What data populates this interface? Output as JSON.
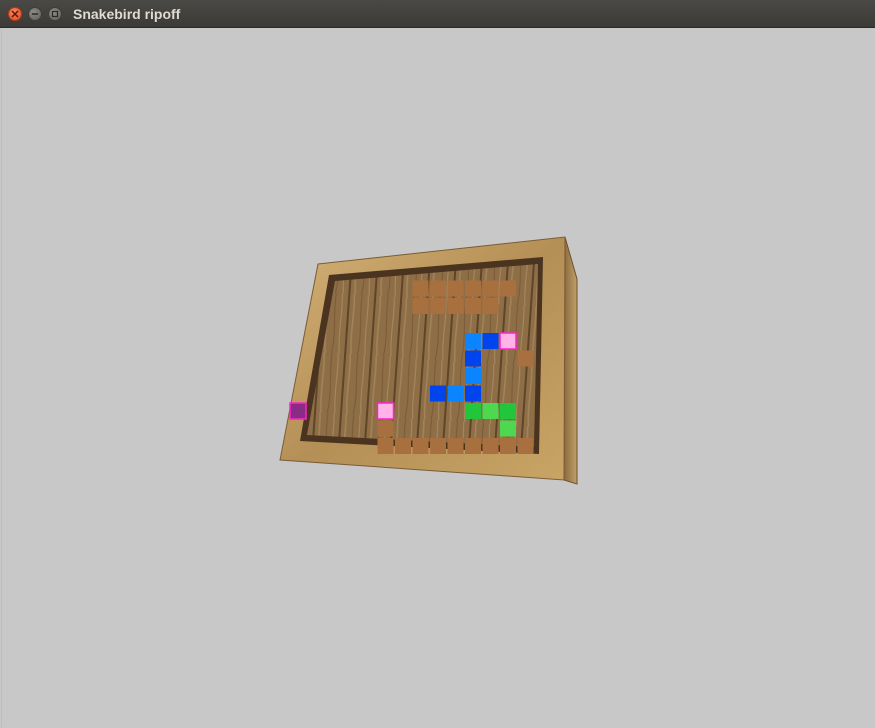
{
  "window": {
    "title": "Snakebird ripoff",
    "close_icon": "close-icon",
    "minimize_icon": "minimize-icon",
    "maximize_icon": "maximize-icon"
  },
  "colors": {
    "background": "#c8c8c8",
    "crate_frame": "#c9a468",
    "crate_planks": "#8e6e46",
    "dirt": "#a9703f",
    "snake_blue": "#0a84ff",
    "snake_blue_dark": "#0044ee",
    "snake_green": "#22c63a",
    "snake_green_light": "#4dd84f",
    "fruit": "#ffb3e6",
    "fruit_border": "#ff22cc",
    "exit": "#8a2c86"
  },
  "level": {
    "dirt_cells": [
      [
        3,
        1
      ],
      [
        4,
        1
      ],
      [
        5,
        1
      ],
      [
        6,
        1
      ],
      [
        7,
        1
      ],
      [
        8,
        1
      ],
      [
        3,
        2
      ],
      [
        4,
        2
      ],
      [
        5,
        2
      ],
      [
        6,
        2
      ],
      [
        7,
        2
      ],
      [
        9,
        5
      ],
      [
        1,
        9
      ],
      [
        1,
        10
      ],
      [
        2,
        10
      ],
      [
        3,
        10
      ],
      [
        4,
        10
      ],
      [
        5,
        10
      ],
      [
        6,
        10
      ],
      [
        7,
        10
      ],
      [
        8,
        10
      ],
      [
        9,
        10
      ]
    ],
    "blue_snake": [
      {
        "c": 6,
        "r": 4,
        "shade": "light"
      },
      {
        "c": 7,
        "r": 4,
        "shade": "dark"
      },
      {
        "c": 6,
        "r": 5,
        "shade": "dark"
      },
      {
        "c": 6,
        "r": 6,
        "shade": "light"
      },
      {
        "c": 6,
        "r": 7,
        "shade": "dark"
      },
      {
        "c": 5,
        "r": 7,
        "shade": "light"
      },
      {
        "c": 4,
        "r": 7,
        "shade": "dark"
      }
    ],
    "green_snake": [
      {
        "c": 6,
        "r": 8,
        "shade": "dark"
      },
      {
        "c": 7,
        "r": 8,
        "shade": "light"
      },
      {
        "c": 8,
        "r": 8,
        "shade": "dark"
      },
      {
        "c": 8,
        "r": 9,
        "shade": "light"
      }
    ],
    "fruits": [
      [
        8,
        4
      ],
      [
        1,
        8
      ]
    ],
    "exit": [
      -1,
      8
    ]
  }
}
